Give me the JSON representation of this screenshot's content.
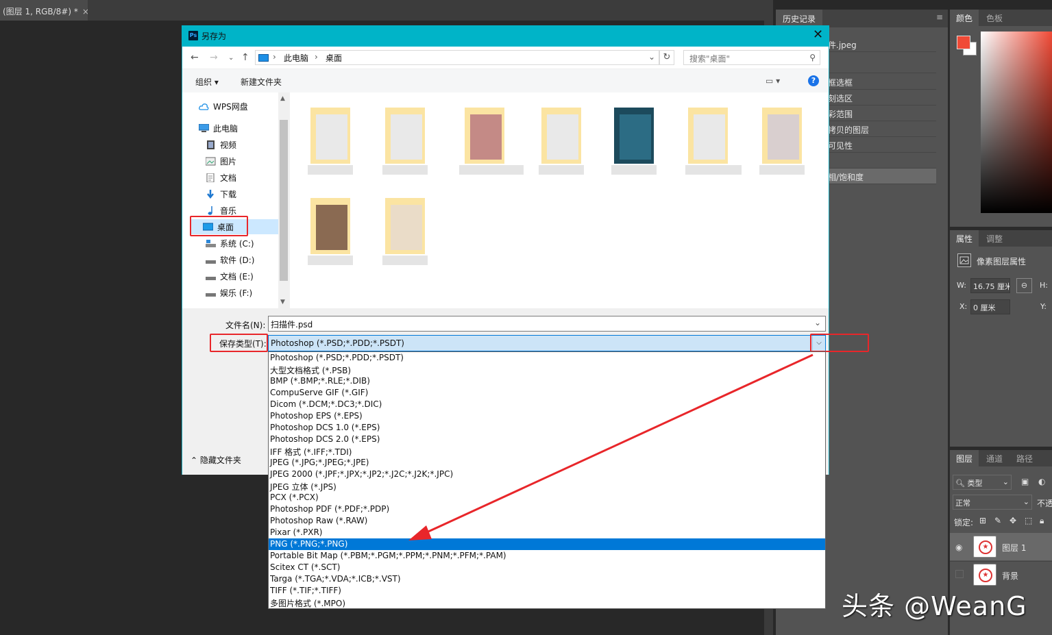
{
  "photoshop": {
    "doc_tab": "(图层 1, RGB/8#) *",
    "doc_tab_close": "×",
    "history": {
      "title": "历史记录",
      "menu": "≡",
      "items": [
        "件.jpeg",
        "",
        "框选框",
        "刻选区",
        "彩范围",
        "拷贝的图层",
        "可见性",
        "",
        "相/饱和度"
      ]
    },
    "color": {
      "tabs": [
        "颜色",
        "色板"
      ],
      "fg_hex": "#f04a36"
    },
    "properties": {
      "tabs": [
        "属性",
        "调整"
      ],
      "heading": "像素图层属性",
      "w_label": "W:",
      "w_value": "16.75 厘米",
      "h_label": "H:",
      "x_label": "X:",
      "x_value": "0 厘米",
      "y_label": "Y:"
    },
    "layers": {
      "tabs": [
        "图层",
        "通道",
        "路径"
      ],
      "filter": "类型",
      "blend": "正常",
      "opacity_label": "不透",
      "lock_label": "锁定:",
      "items": [
        {
          "name": "图层 1",
          "visible": true,
          "selected": true
        },
        {
          "name": "背景",
          "visible": false,
          "selected": false
        }
      ]
    },
    "watermark": "头条 @WeanG"
  },
  "dialog": {
    "app_icon": "Ps",
    "title": "另存为",
    "close": "✕",
    "address": {
      "root": "此电脑",
      "current": "桌面"
    },
    "search_placeholder": "搜索\"桌面\"",
    "toolbar": {
      "organize": "组织 ▾",
      "new_folder": "新建文件夹",
      "help": "?"
    },
    "nav": [
      {
        "label": "WPS网盘",
        "icon": "cloud-icon"
      },
      {
        "label": "此电脑",
        "icon": "computer-icon"
      },
      {
        "label": "视频",
        "icon": "video-icon"
      },
      {
        "label": "图片",
        "icon": "picture-icon"
      },
      {
        "label": "文档",
        "icon": "document-icon"
      },
      {
        "label": "下载",
        "icon": "download-icon"
      },
      {
        "label": "音乐",
        "icon": "music-icon"
      },
      {
        "label": "桌面",
        "icon": "desktop-icon",
        "selected": true
      },
      {
        "label": "系统 (C:)",
        "icon": "drive-icon"
      },
      {
        "label": "软件 (D:)",
        "icon": "drive-icon"
      },
      {
        "label": "文档 (E:)",
        "icon": "drive-icon"
      },
      {
        "label": "娱乐 (F:)",
        "icon": "drive-icon"
      }
    ],
    "filename_label": "文件名(N):",
    "filename_value": "扫描件.psd",
    "filetype_label": "保存类型(T):",
    "filetype_value": "Photoshop (*.PSD;*.PDD;*.PSDT)",
    "hide_folders": "隐藏文件夹",
    "filetype_options": [
      "Photoshop (*.PSD;*.PDD;*.PSDT)",
      "大型文档格式 (*.PSB)",
      "BMP (*.BMP;*.RLE;*.DIB)",
      "CompuServe GIF (*.GIF)",
      "Dicom (*.DCM;*.DC3;*.DIC)",
      "Photoshop EPS (*.EPS)",
      "Photoshop DCS 1.0 (*.EPS)",
      "Photoshop DCS 2.0 (*.EPS)",
      "IFF 格式 (*.IFF;*.TDI)",
      "JPEG (*.JPG;*.JPEG;*.JPE)",
      "JPEG 2000 (*.JPF;*.JPX;*.JP2;*.J2C;*.J2K;*.JPC)",
      "JPEG 立体 (*.JPS)",
      "PCX (*.PCX)",
      "Photoshop PDF (*.PDF;*.PDP)",
      "Photoshop Raw (*.RAW)",
      "Pixar (*.PXR)",
      "PNG (*.PNG;*.PNG)",
      "Portable Bit Map (*.PBM;*.PGM;*.PPM;*.PNM;*.PFM;*.PAM)",
      "Scitex CT (*.SCT)",
      "Targa (*.TGA;*.VDA;*.ICB;*.VST)",
      "TIFF (*.TIF;*.TIFF)",
      "多图片格式 (*.MPO)"
    ],
    "selected_option": "PNG (*.PNG;*.PNG)"
  }
}
